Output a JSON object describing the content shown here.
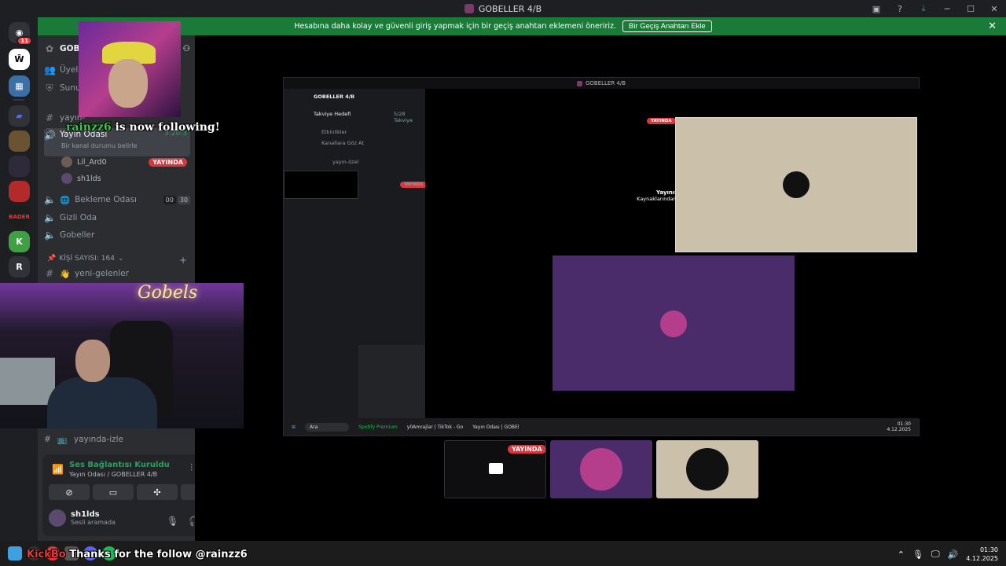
{
  "window": {
    "title": "GOBELLER 4/B"
  },
  "notice": {
    "message": "Hesabına daha kolay ve güvenli giriş yapmak için bir geçiş anahtarı eklemeni öneririz.",
    "button": "Bir Geçiş Anahtarı Ekle",
    "close": "✕"
  },
  "rail": {
    "dm_badge": "11",
    "last_server": "R"
  },
  "sidebar": {
    "server_name": "GOBE",
    "items": [
      {
        "label": "Üyele",
        "icon": "users-icon"
      },
      {
        "label": "Sunu",
        "icon": "shield-icon"
      },
      {
        "label": "yayın-",
        "icon": "hash-icon"
      }
    ],
    "voice_channel": {
      "label": "Yayın Odası",
      "timer": "3:20:3",
      "status": "Bir kanal durumu belirle"
    },
    "members": [
      {
        "name": "Lil_Ard0",
        "live": "YAYINDA"
      },
      {
        "name": "sh1lds"
      }
    ],
    "waiting": {
      "label": "Bekleme Odası",
      "count_a": "00",
      "count_b": "30"
    },
    "hidden_room": "Gizli Oda",
    "gobeller": "Gobeller",
    "category": "KİŞİ SAYISI: 164",
    "new_channel": "yeni-gelenler",
    "watch_channel": "yayında-izle"
  },
  "overlay": {
    "follower": "rainzz6",
    "follow_text": " is now following!",
    "thanks_prefix": "Kick",
    "thanks_cut": "Bo",
    "thanks_text": " Thanks for the follow @rainzz6",
    "neon": "Gobels"
  },
  "voice_panel": {
    "connected": "Ses Bağlantısı Kuruldu",
    "room": "Yayın Odası / GOBELLER 4/B",
    "username": "sh1lds",
    "user_status": "Sesli aramada"
  },
  "stream": {
    "mini_title": "GOBELLER 4/B",
    "server": "GOBELLER 4/B",
    "goal": "Takviye Hedefi",
    "goal_count": "5/28 Takviye",
    "events": "Etkinlikler",
    "browse": "Kanallara Göz At",
    "channel": "yayın-özel",
    "live": "YAYINDA",
    "paused_title": "Yayının halen devam ediyor!",
    "paused_text": "Kaynaklarından tasarruf etmek için bu önizlemeyi duraklattık.",
    "mini_search": "Ara",
    "mini_app1": "Spotify Premium",
    "mini_app2": "y0Amrajlar | TikTok - Go",
    "mini_app3": "Yayın Odası | GOBEl",
    "mini_time": "01:30",
    "mini_date": "4.12.2025"
  },
  "thumbs": {
    "live": "YAYINDA"
  },
  "clock": {
    "time": "01:30",
    "date": "4.12.2025"
  }
}
